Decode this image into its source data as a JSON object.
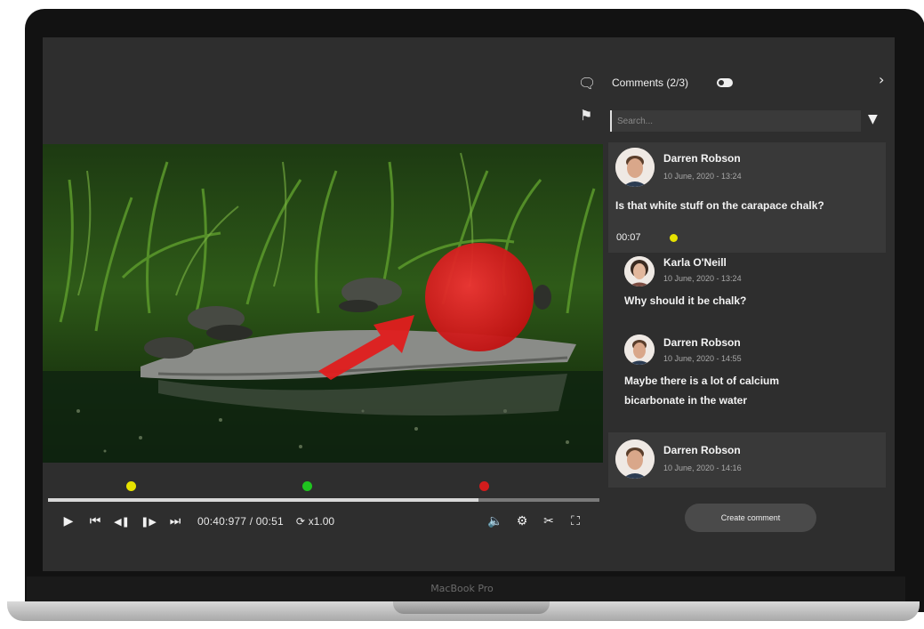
{
  "device": {
    "brand_label": "MacBook Pro"
  },
  "player": {
    "timecode": "00:40:977 / 00:51",
    "speed": "x1.00",
    "progress_fraction": 0.78,
    "markers": [
      {
        "color": "#e6e200",
        "position_fraction": 0.15
      },
      {
        "color": "#1fc41f",
        "position_fraction": 0.47
      },
      {
        "color": "#d21c1c",
        "position_fraction": 0.79
      }
    ],
    "controls": {
      "play_icon": "play-icon",
      "skip_start_icon": "skip-to-start-icon",
      "prev_frame_icon": "previous-frame-icon",
      "next_frame_icon": "next-frame-icon",
      "skip_end_icon": "skip-to-end-icon",
      "speed_icon": "speed-icon",
      "volume_icon": "volume-icon",
      "settings_icon": "gear-icon",
      "cut_icon": "scissors-icon",
      "fullscreen_icon": "fullscreen-icon"
    }
  },
  "comments_panel": {
    "title": "Comments (2/3)",
    "search_placeholder": "Search...",
    "create_button": "Create comment",
    "comments": [
      {
        "author": "Darren Robson",
        "date": "10 June, 2020 - 13:24",
        "text": "Is that white stuff on the carapace chalk?",
        "timestamp": "00:07",
        "marker_color": "#e6e200",
        "replies": [
          {
            "author": "Karla O'Neill",
            "date": "10 June, 2020 - 13:24",
            "text": "Why should it be chalk?"
          },
          {
            "author": "Darren Robson",
            "date": "10 June, 2020 - 14:55",
            "text_line1": "Maybe there is a lot of calcium",
            "text_line2": "bicarbonate in the water"
          }
        ]
      },
      {
        "author": "Darren Robson",
        "date": "10 June, 2020 - 14:16"
      }
    ]
  },
  "colors": {
    "screen_bg": "#2e2e2e",
    "card_bg": "#393939",
    "annotation_red": "#e01e1e"
  }
}
